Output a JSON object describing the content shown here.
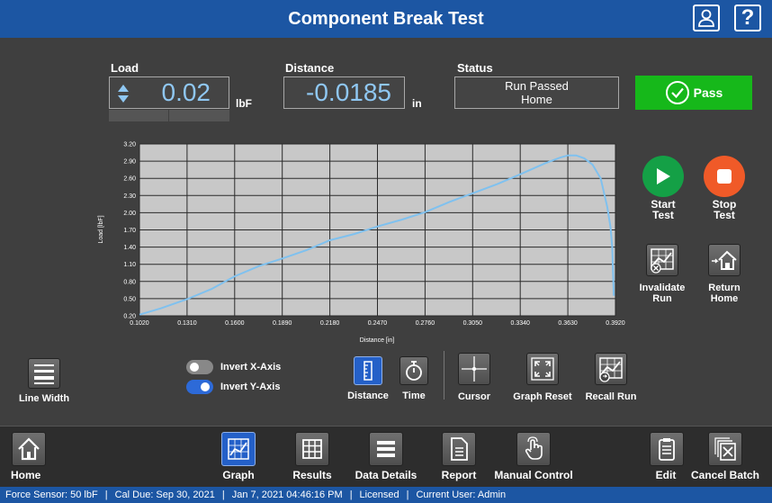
{
  "header": {
    "title": "Component Break Test"
  },
  "load": {
    "label": "Load",
    "value": "0.02",
    "unit": "lbF"
  },
  "distance": {
    "label": "Distance",
    "value": "-0.0185",
    "unit": "in"
  },
  "status": {
    "label": "Status",
    "line1": "Run Passed",
    "line2": "Home"
  },
  "result": {
    "label": "Pass",
    "color": "#16b81a"
  },
  "controls": {
    "start": {
      "line1": "Start",
      "line2": "Test",
      "color": "#14a046"
    },
    "stop": {
      "line1": "Stop",
      "line2": "Test",
      "color": "#f05a28"
    },
    "invalidate": {
      "line1": "Invalidate",
      "line2": "Run"
    },
    "return": {
      "line1": "Return",
      "line2": "Home"
    }
  },
  "graph_toolbar": {
    "line_width": "Line Width",
    "invert_x": {
      "label": "Invert X-Axis",
      "on": false
    },
    "invert_y": {
      "label": "Invert Y-Axis",
      "on": true
    },
    "distance": "Distance",
    "time": "Time",
    "cursor": "Cursor",
    "graph_reset": "Graph Reset",
    "recall_run": "Recall Run"
  },
  "nav": {
    "home": "Home",
    "graph": "Graph",
    "results": "Results",
    "data_details": "Data Details",
    "report": "Report",
    "manual_control": "Manual Control",
    "edit": "Edit",
    "cancel_batch": "Cancel Batch"
  },
  "statusbar": {
    "sensor": "Force Sensor: 50 lbF",
    "cal_due": "Cal Due: Sep 30, 2021",
    "datetime": "Jan 7, 2021 04:46:16 PM",
    "license": "Licensed",
    "user": "Current User: Admin"
  },
  "chart_data": {
    "type": "line",
    "xlabel": "Distance [in]",
    "ylabel": "Load [lbF]",
    "xlim": [
      0.102,
      0.392
    ],
    "ylim": [
      0.2,
      3.2
    ],
    "xticks": [
      "0.1020",
      "0.1310",
      "0.1600",
      "0.1890",
      "0.2180",
      "0.2470",
      "0.2760",
      "0.3050",
      "0.3340",
      "0.3630",
      "0.3920"
    ],
    "yticks": [
      "0.20",
      "0.50",
      "0.80",
      "1.10",
      "1.40",
      "1.70",
      "2.00",
      "2.30",
      "2.60",
      "2.90",
      "3.20"
    ],
    "grid": true,
    "line_color": "#7fc1ef",
    "x": [
      0.102,
      0.115,
      0.131,
      0.146,
      0.16,
      0.175,
      0.189,
      0.204,
      0.218,
      0.233,
      0.247,
      0.262,
      0.276,
      0.291,
      0.305,
      0.32,
      0.334,
      0.349,
      0.358,
      0.363,
      0.368,
      0.373,
      0.378,
      0.383,
      0.387,
      0.389,
      0.39,
      0.391
    ],
    "y": [
      0.22,
      0.33,
      0.49,
      0.67,
      0.89,
      1.07,
      1.2,
      1.35,
      1.52,
      1.63,
      1.76,
      1.88,
      2.01,
      2.19,
      2.34,
      2.5,
      2.67,
      2.86,
      2.96,
      3.0,
      3.0,
      2.95,
      2.84,
      2.6,
      2.1,
      1.75,
      1.4,
      0.55
    ]
  }
}
